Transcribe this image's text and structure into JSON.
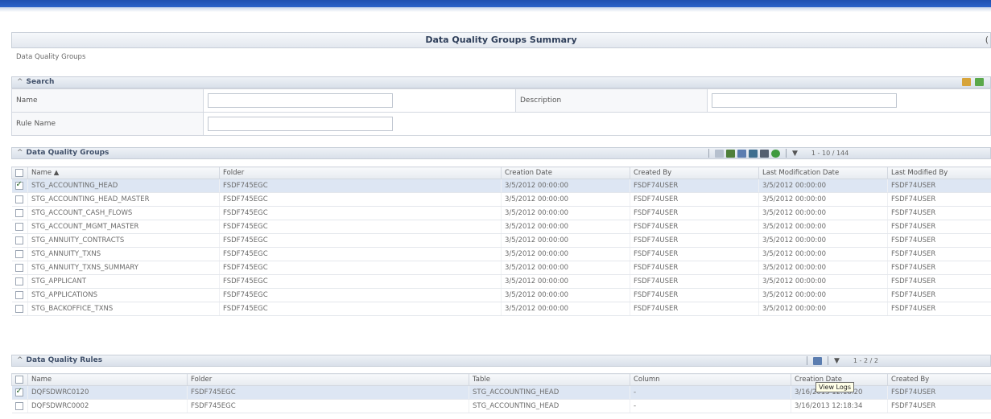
{
  "page": {
    "title": "Data Quality Groups Summary",
    "help_glyph": "(",
    "breadcrumb": "Data Quality Groups"
  },
  "search": {
    "title": "Search",
    "collapse_arrow": "^",
    "name_label": "Name",
    "name_value": "",
    "description_label": "Description",
    "description_value": "",
    "rule_name_label": "Rule Name",
    "rule_name_value": "",
    "icons": [
      "search-icon",
      "reset-icon"
    ]
  },
  "groups": {
    "title": "Data Quality Groups",
    "collapse_arrow": "^",
    "pager": "1 - 10 / 144",
    "toolbar_icons": [
      "view-icon",
      "add-icon",
      "edit-icon",
      "copy-icon",
      "delete-icon",
      "run-icon",
      "filter-icon"
    ],
    "columns": [
      "Name ▲",
      "Folder",
      "Creation Date",
      "Created By",
      "Last Modification Date",
      "Last Modified By"
    ],
    "rows": [
      {
        "checked": true,
        "name": "STG_ACCOUNTING_HEAD",
        "folder": "FSDF745EGC",
        "created": "3/5/2012 00:00:00",
        "by": "FSDF74USER",
        "modified": "3/5/2012 00:00:00",
        "modified_by": "FSDF74USER"
      },
      {
        "checked": false,
        "name": "STG_ACCOUNTING_HEAD_MASTER",
        "folder": "FSDF745EGC",
        "created": "3/5/2012 00:00:00",
        "by": "FSDF74USER",
        "modified": "3/5/2012 00:00:00",
        "modified_by": "FSDF74USER"
      },
      {
        "checked": false,
        "name": "STG_ACCOUNT_CASH_FLOWS",
        "folder": "FSDF745EGC",
        "created": "3/5/2012 00:00:00",
        "by": "FSDF74USER",
        "modified": "3/5/2012 00:00:00",
        "modified_by": "FSDF74USER"
      },
      {
        "checked": false,
        "name": "STG_ACCOUNT_MGMT_MASTER",
        "folder": "FSDF745EGC",
        "created": "3/5/2012 00:00:00",
        "by": "FSDF74USER",
        "modified": "3/5/2012 00:00:00",
        "modified_by": "FSDF74USER"
      },
      {
        "checked": false,
        "name": "STG_ANNUITY_CONTRACTS",
        "folder": "FSDF745EGC",
        "created": "3/5/2012 00:00:00",
        "by": "FSDF74USER",
        "modified": "3/5/2012 00:00:00",
        "modified_by": "FSDF74USER"
      },
      {
        "checked": false,
        "name": "STG_ANNUITY_TXNS",
        "folder": "FSDF745EGC",
        "created": "3/5/2012 00:00:00",
        "by": "FSDF74USER",
        "modified": "3/5/2012 00:00:00",
        "modified_by": "FSDF74USER"
      },
      {
        "checked": false,
        "name": "STG_ANNUITY_TXNS_SUMMARY",
        "folder": "FSDF745EGC",
        "created": "3/5/2012 00:00:00",
        "by": "FSDF74USER",
        "modified": "3/5/2012 00:00:00",
        "modified_by": "FSDF74USER"
      },
      {
        "checked": false,
        "name": "STG_APPLICANT",
        "folder": "FSDF745EGC",
        "created": "3/5/2012 00:00:00",
        "by": "FSDF74USER",
        "modified": "3/5/2012 00:00:00",
        "modified_by": "FSDF74USER"
      },
      {
        "checked": false,
        "name": "STG_APPLICATIONS",
        "folder": "FSDF745EGC",
        "created": "3/5/2012 00:00:00",
        "by": "FSDF74USER",
        "modified": "3/5/2012 00:00:00",
        "modified_by": "FSDF74USER"
      },
      {
        "checked": false,
        "name": "STG_BACKOFFICE_TXNS",
        "folder": "FSDF745EGC",
        "created": "3/5/2012 00:00:00",
        "by": "FSDF74USER",
        "modified": "3/5/2012 00:00:00",
        "modified_by": "FSDF74USER"
      }
    ]
  },
  "rules": {
    "title": "Data Quality Rules",
    "collapse_arrow": "^",
    "pager": "1 - 2 / 2",
    "toolbar_icons": [
      "view-logs-icon",
      "filter-icon"
    ],
    "tooltip": "View Logs",
    "columns": [
      "Name",
      "Folder",
      "Table",
      "Column",
      "Creation Date",
      "Created By"
    ],
    "rows": [
      {
        "checked": true,
        "name": "DQFSDWRC0120",
        "folder": "FSDF745EGC",
        "table": "STG_ACCOUNTING_HEAD",
        "column": "-",
        "created": "3/16/2013 12:18:20",
        "by": "FSDF74USER"
      },
      {
        "checked": false,
        "name": "DQFSDWRC0002",
        "folder": "FSDF745EGC",
        "table": "STG_ACCOUNTING_HEAD",
        "column": "-",
        "created": "3/16/2013 12:18:34",
        "by": "FSDF74USER"
      }
    ]
  },
  "colors": {
    "accent": "#2b62c9",
    "selected_row": "#dde6f3",
    "header_bg": "#e3e8ef"
  }
}
